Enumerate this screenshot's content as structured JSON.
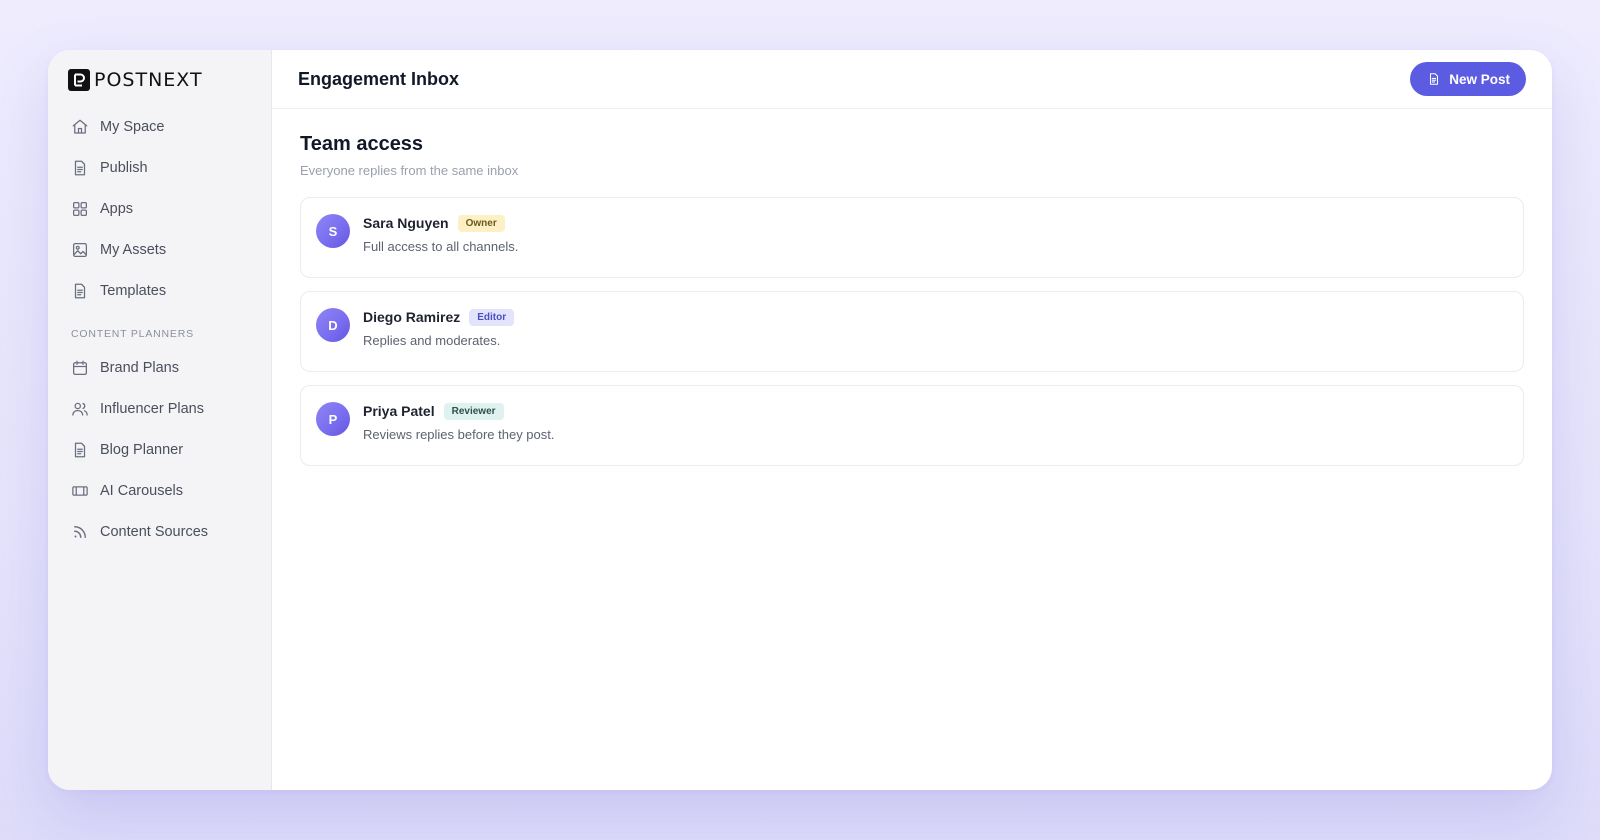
{
  "brand": {
    "name": "POSTNEXT"
  },
  "sidebar": {
    "items": [
      {
        "label": "My Space",
        "icon": "home-icon"
      },
      {
        "label": "Publish",
        "icon": "document-icon"
      },
      {
        "label": "Apps",
        "icon": "grid-icon"
      },
      {
        "label": "My Assets",
        "icon": "image-icon"
      },
      {
        "label": "Templates",
        "icon": "document-icon"
      }
    ],
    "section_title": "CONTENT PLANNERS",
    "planner_items": [
      {
        "label": "Brand Plans",
        "icon": "calendar-icon"
      },
      {
        "label": "Influencer Plans",
        "icon": "users-icon"
      },
      {
        "label": "Blog Planner",
        "icon": "document-icon"
      },
      {
        "label": "AI Carousels",
        "icon": "carousel-icon"
      },
      {
        "label": "Content Sources",
        "icon": "rss-icon"
      }
    ]
  },
  "header": {
    "title": "Engagement Inbox",
    "new_post_label": "New Post"
  },
  "main": {
    "heading": "Team access",
    "subheading": "Everyone replies from the same inbox",
    "members": [
      {
        "initial": "S",
        "name": "Sara Nguyen",
        "role": "Owner",
        "description": "Full access to all channels."
      },
      {
        "initial": "D",
        "name": "Diego Ramirez",
        "role": "Editor",
        "description": "Replies and moderates."
      },
      {
        "initial": "P",
        "name": "Priya Patel",
        "role": "Reviewer",
        "description": "Reviews replies before they post."
      }
    ]
  },
  "colors": {
    "accent": "#5b5ce2",
    "owner_badge_bg": "#fcf0c4",
    "owner_badge_text": "#6b5a1e",
    "editor_badge_bg": "#e2e4fb",
    "editor_badge_text": "#4b4fc4",
    "reviewer_badge_bg": "#dff2ef",
    "reviewer_badge_text": "#2f4f4a"
  }
}
